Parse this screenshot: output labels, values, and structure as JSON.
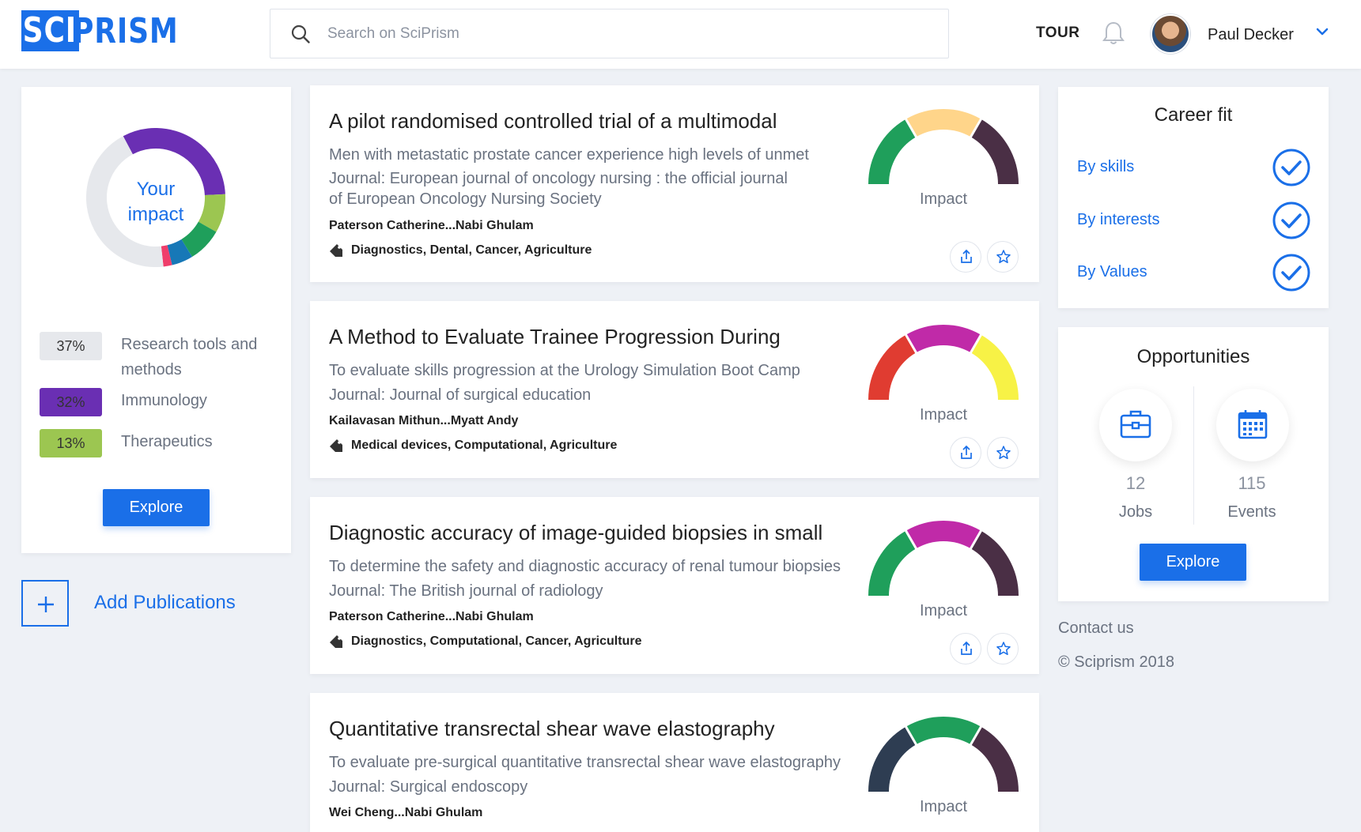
{
  "header": {
    "logo_left": "SCI",
    "logo_right": "PRISM",
    "search_placeholder": "Search on SciPrism",
    "tour_label": "TOUR",
    "user_name": "Paul Decker"
  },
  "impact": {
    "title_line1": "Your",
    "title_line2": "impact",
    "legend": [
      {
        "pct": "37%",
        "label": "Research tools and methods",
        "color": "#e6e8ec"
      },
      {
        "pct": "32%",
        "label": "Immunology",
        "color": "#6a2fb3"
      },
      {
        "pct": "13%",
        "label": "Therapeutics",
        "color": "#9cc651"
      }
    ],
    "segments": [
      {
        "value": 32,
        "color": "#6a2fb3"
      },
      {
        "value": 9,
        "color": "#9cc651"
      },
      {
        "value": 8,
        "color": "#1f9f5b"
      },
      {
        "value": 5,
        "color": "#1778b7"
      },
      {
        "value": 2,
        "color": "#ef3e6b"
      },
      {
        "value": 44,
        "color": "#e6e8ec"
      }
    ],
    "explore_label": "Explore"
  },
  "add_publications_label": "Add Publications",
  "publications": [
    {
      "title": "A pilot randomised controlled trial of a multimodal",
      "abstract": "Men with metastatic prostate cancer experience high levels of unmet",
      "journal": "Journal: European journal of oncology nursing : the official journal of European Oncology Nursing Society",
      "authors": "Paterson Catherine...Nabi Ghulam",
      "tags": "Diagnostics, Dental, Cancer, Agriculture",
      "impact_label": "Impact",
      "gauge_colors": [
        "#1f9f5b",
        "#ffd58a",
        "#4a2f45"
      ]
    },
    {
      "title": "A Method to Evaluate Trainee Progression During",
      "abstract": "To evaluate skills progression at the Urology Simulation Boot Camp",
      "journal": "Journal: Journal of surgical education",
      "authors": "Kailavasan Mithun...Myatt Andy",
      "tags": "Medical devices, Computational, Agriculture",
      "impact_label": "Impact",
      "gauge_colors": [
        "#e03c31",
        "#c02aa8",
        "#f7f246"
      ]
    },
    {
      "title": "Diagnostic accuracy of image-guided biopsies in small",
      "abstract": "To determine the safety and diagnostic accuracy of renal tumour biopsies",
      "journal": "Journal: The British journal of radiology",
      "authors": "Paterson Catherine...Nabi Ghulam",
      "tags": "Diagnostics, Computational, Cancer, Agriculture",
      "impact_label": "Impact",
      "gauge_colors": [
        "#1f9f5b",
        "#c02aa8",
        "#4a2f45"
      ]
    },
    {
      "title": "Quantitative transrectal shear wave elastography",
      "abstract": "To evaluate pre-surgical quantitative transrectal shear wave elastography",
      "journal": "Journal: Surgical endoscopy",
      "authors": "Wei Cheng...Nabi Ghulam",
      "tags": "",
      "impact_label": "Impact",
      "gauge_colors": [
        "#2e3d52",
        "#1f9f5b",
        "#4a2f45"
      ]
    }
  ],
  "career_fit": {
    "title": "Career fit",
    "items": [
      {
        "label": "By skills"
      },
      {
        "label": "By interests"
      },
      {
        "label": "By Values"
      }
    ]
  },
  "opportunities": {
    "title": "Opportunities",
    "jobs_count": "12",
    "jobs_label": "Jobs",
    "events_count": "115",
    "events_label": "Events",
    "explore_label": "Explore"
  },
  "footer": {
    "contact": "Contact us",
    "copyright": "© Sciprism 2018"
  },
  "colors": {
    "accent": "#1a6fe8",
    "background": "#eef1f6"
  }
}
